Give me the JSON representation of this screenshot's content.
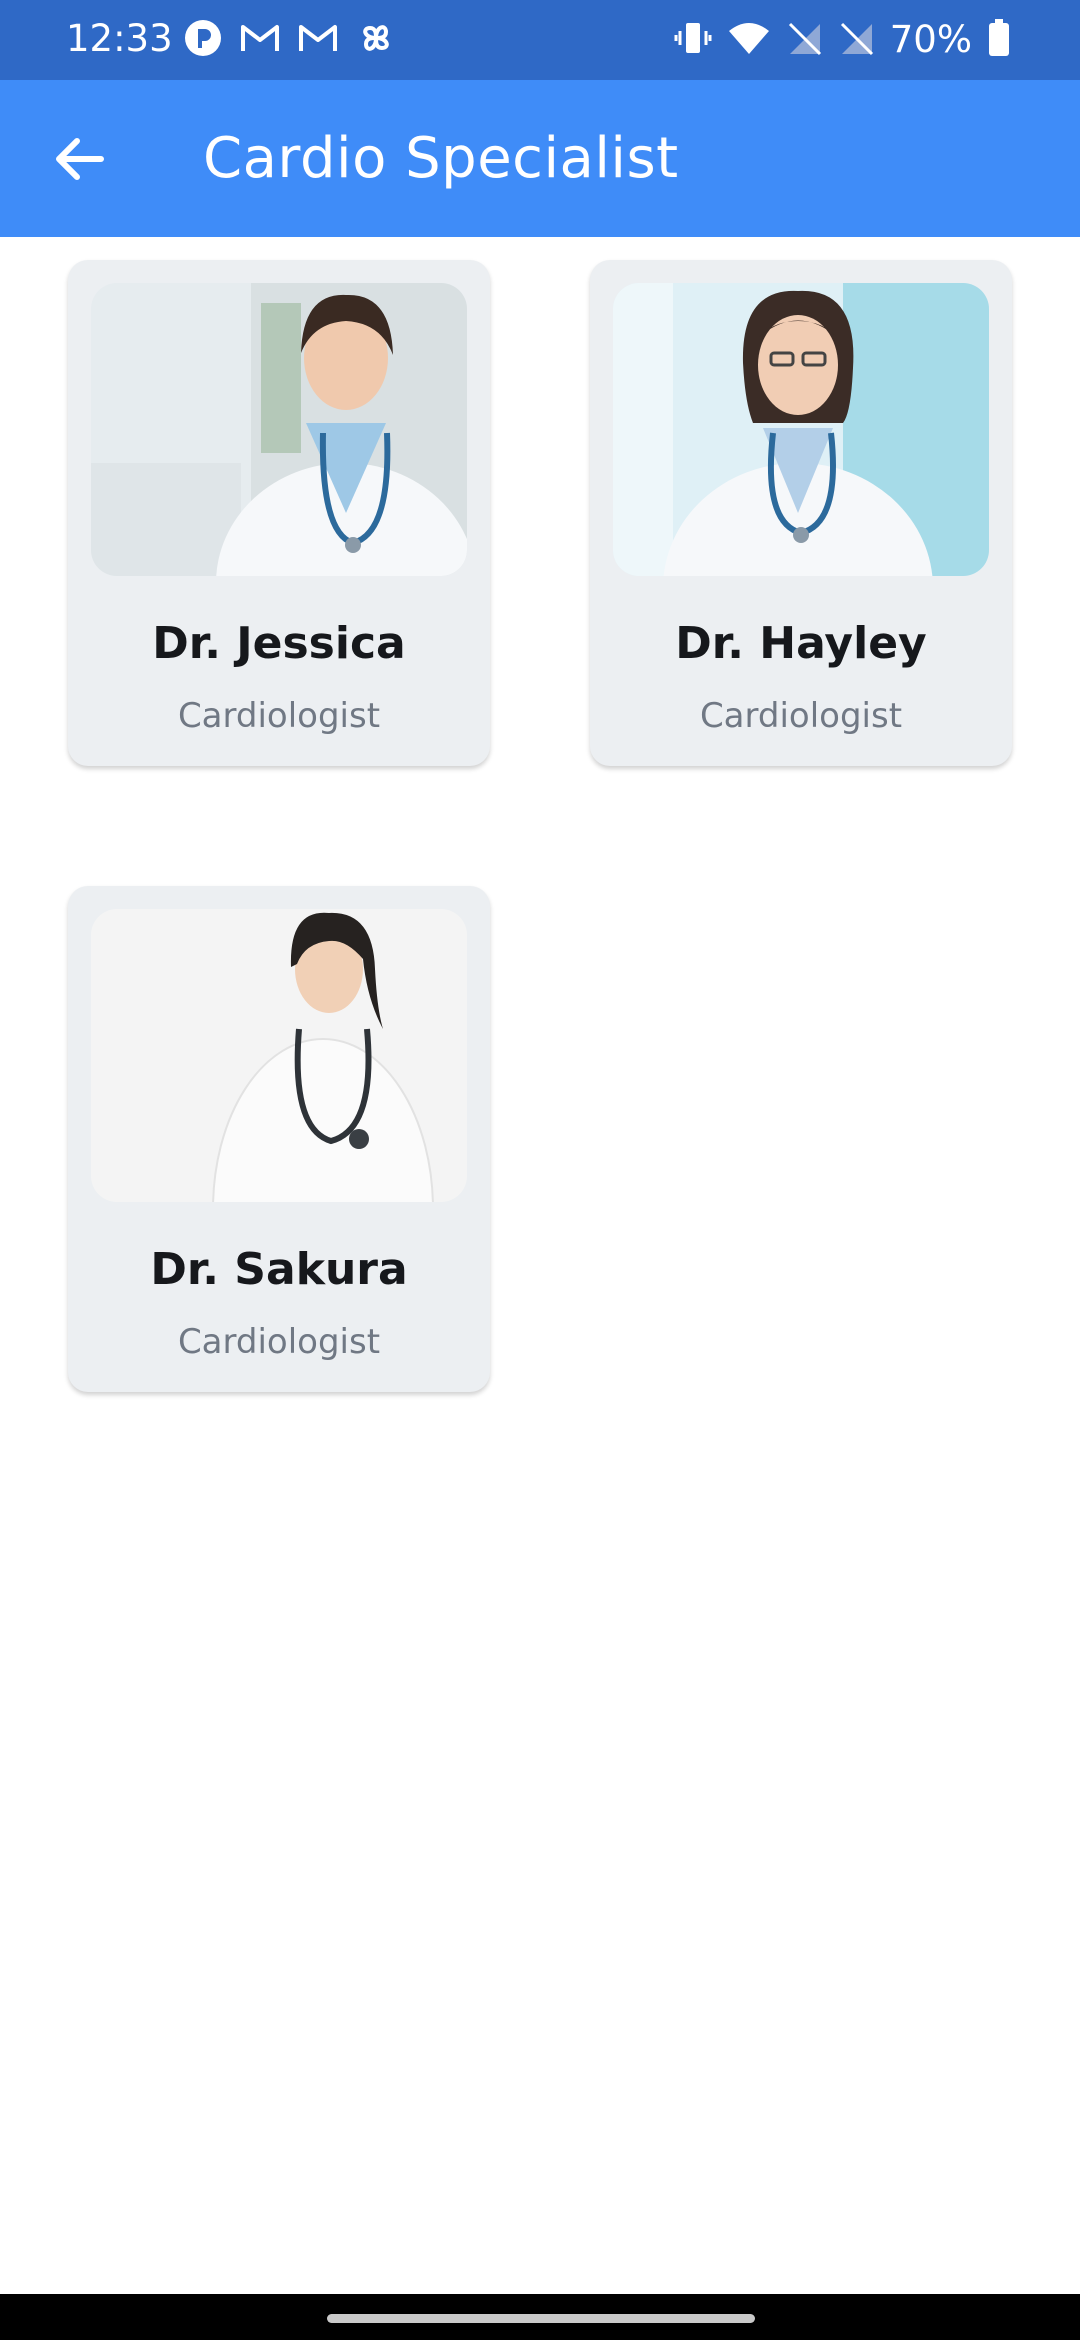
{
  "status_bar": {
    "time": "12:33",
    "battery": "70%",
    "left_icons": [
      "p-app-icon",
      "gmail-icon",
      "gmail-icon",
      "pinwheel-icon"
    ],
    "right_icons": [
      "vibrate-icon",
      "wifi-icon",
      "no-signal-icon",
      "no-signal-icon",
      "battery-icon"
    ]
  },
  "app_bar": {
    "title": "Cardio Specialist",
    "back_icon": "arrow-left-icon",
    "color": "#3f8cf8"
  },
  "doctors": [
    {
      "name": "Dr. Jessica",
      "specialty": "Cardiologist",
      "photo": "doctor-photo"
    },
    {
      "name": "Dr. Hayley",
      "specialty": "Cardiologist",
      "photo": "doctor-photo"
    },
    {
      "name": "Dr. Sakura",
      "specialty": "Cardiologist",
      "photo": "doctor-photo"
    }
  ],
  "colors": {
    "status_bar": "#2f69c6",
    "card_background": "#eceff2",
    "name_text": "#16181c",
    "specialty_text": "#707884"
  }
}
